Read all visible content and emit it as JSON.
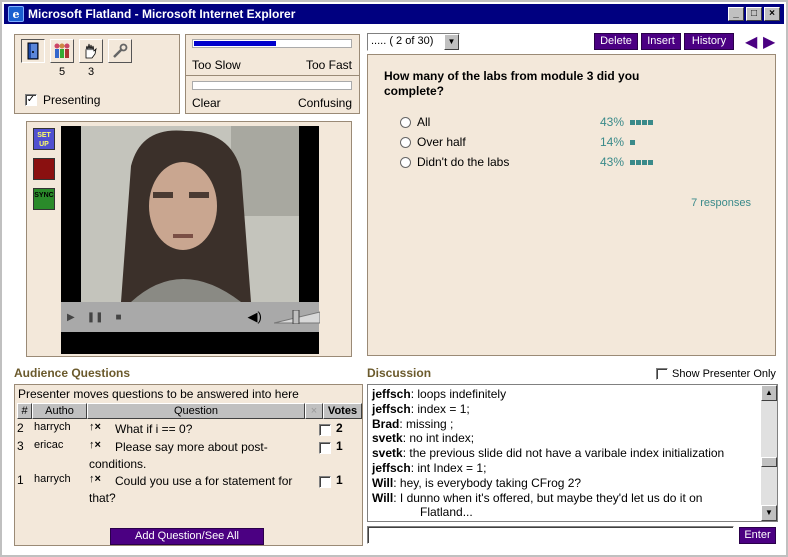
{
  "window": {
    "title": "Microsoft Flatland - Microsoft Internet Explorer",
    "minimize": "_",
    "maximize": "□",
    "close": "×"
  },
  "toolbar": {
    "audience_count": "5",
    "raised_hands_count": "3",
    "presenting_label": "Presenting",
    "presenting_checked": "✓"
  },
  "feedback": {
    "speed_fill": 0.52,
    "speed_left": "Too Slow",
    "speed_right": "Too Fast",
    "clarity_fill": 0,
    "clarity_left": "Clear",
    "clarity_right": "Confusing"
  },
  "video": {
    "buttons": [
      "SET UP",
      "",
      "SYNC"
    ]
  },
  "slide_nav": {
    "page_select": "..... ( 2 of 30)",
    "delete_label": "Delete",
    "insert_label": "Insert",
    "history_label": "History",
    "prev": "◀",
    "next": "▶"
  },
  "question": {
    "text": "How many of the labs from module 3 did you complete?",
    "options": [
      {
        "label": "All",
        "percent": "43%",
        "blocks": 4
      },
      {
        "label": "Over half",
        "percent": "14%",
        "blocks": 1
      },
      {
        "label": "Didn't do the labs",
        "percent": "43%",
        "blocks": 4
      }
    ],
    "responses": "7 responses"
  },
  "audience_questions": {
    "section_label": "Audience Questions",
    "header_note": "Presenter moves questions to be answered into here",
    "columns": [
      "#",
      "Autho",
      "Question",
      "×",
      "Votes"
    ],
    "rows": [
      {
        "num": "2",
        "author": "harrych",
        "icons": "↑×",
        "question": "What if i == 0?",
        "votes": "2"
      },
      {
        "num": "3",
        "author": "ericac",
        "icons": "↑×",
        "question": "Please say more about post-conditions.",
        "votes": "1"
      },
      {
        "num": "1",
        "author": "harrych",
        "icons": "↑×",
        "question": "Could you use a for statement for that?",
        "votes": "1"
      }
    ],
    "add_button": "Add Question/See All"
  },
  "discussion": {
    "section_label": "Discussion",
    "show_presenter_only": "Show Presenter Only",
    "messages": [
      {
        "user": "jeffsch",
        "text": ": loops indefinitely"
      },
      {
        "user": "jeffsch",
        "text": ": index = 1;"
      },
      {
        "user": "Brad",
        "text": ": missing ;"
      },
      {
        "user": "svetk",
        "text": ": no int index;"
      },
      {
        "user": "svetk",
        "text": ": the previous slide did not have a varibale index initialization"
      },
      {
        "user": "jeffsch",
        "text": ": int Index = 1;"
      },
      {
        "user": "Will",
        "text": ": hey, is everybody taking CFrog 2?"
      },
      {
        "user": "Will",
        "text": ": I dunno when it's offered, but maybe they'd let us do it on"
      }
    ],
    "continuation": "Flatland...",
    "enter_label": "Enter"
  }
}
